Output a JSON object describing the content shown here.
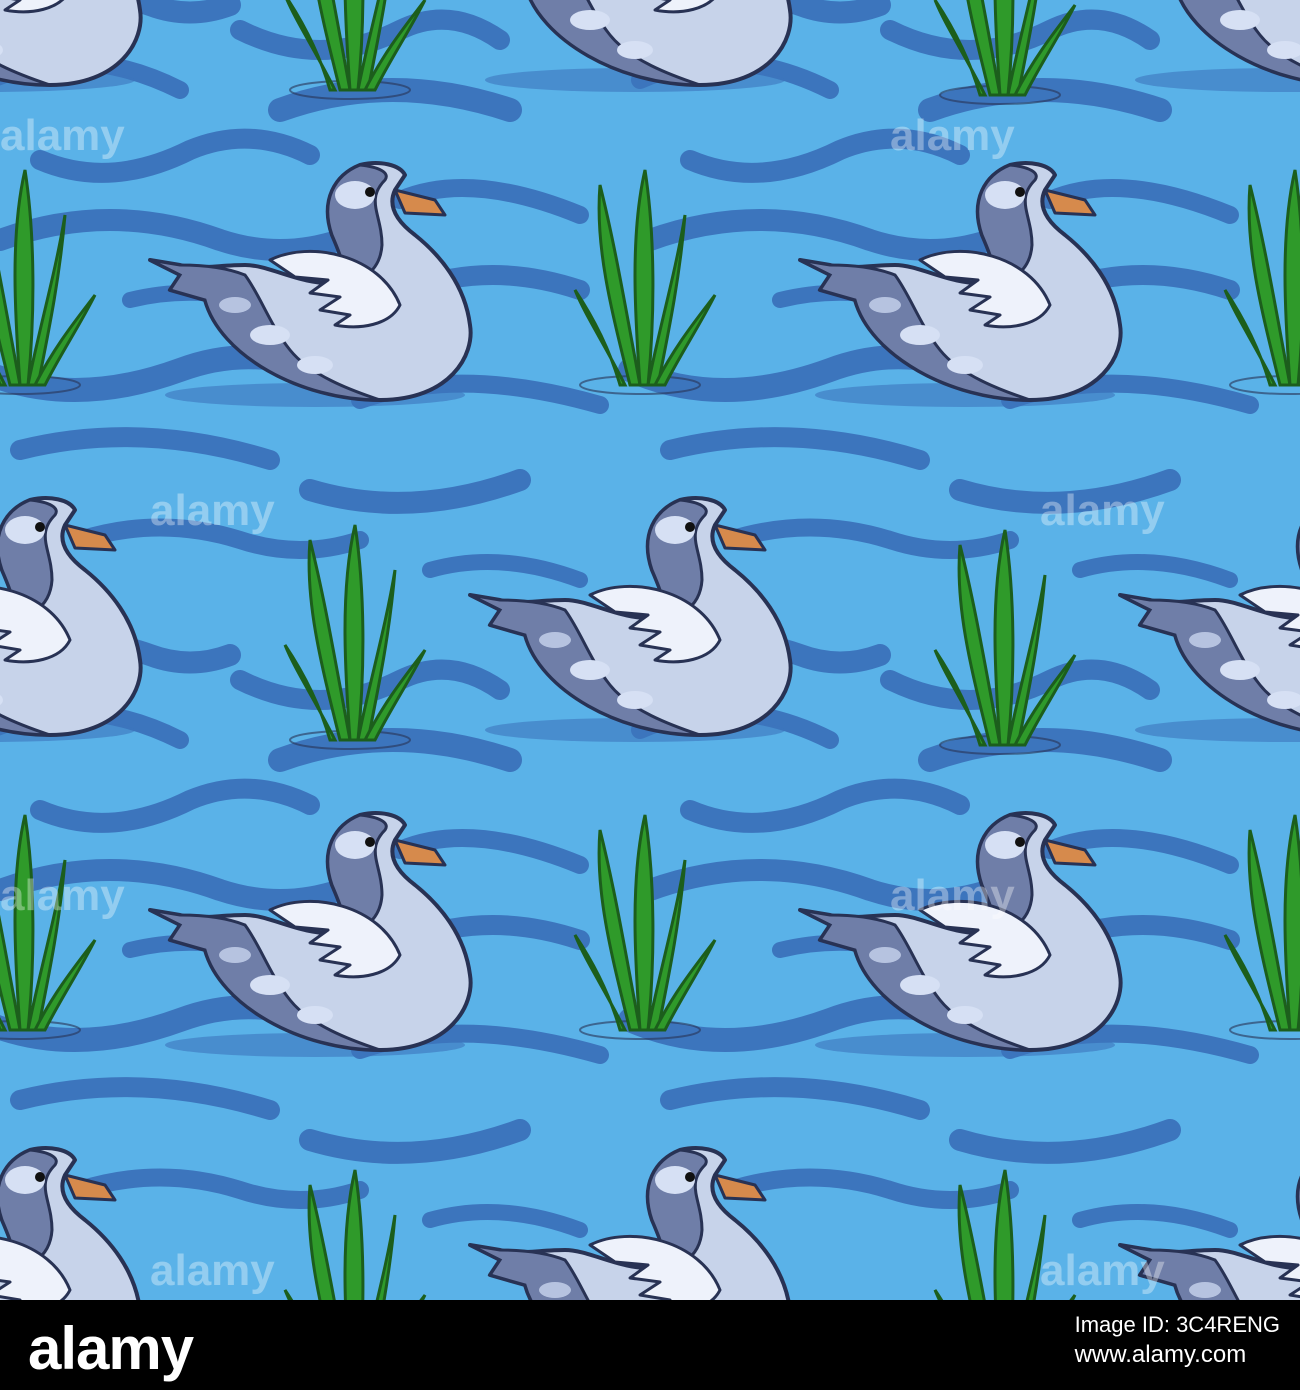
{
  "image": {
    "subject": "seamless pattern of grey swans and green reeds on blue rippled water",
    "colors": {
      "water": "#5ab2e8",
      "ripple": "#3c75bd",
      "swan_body": "#c7d3ea",
      "swan_dark": "#6f7ea8",
      "swan_outline": "#283254",
      "beak": "#d68a4c",
      "reed": "#2f9a2a",
      "reed_dark": "#1c5e1c"
    }
  },
  "watermark": {
    "text": "alamy"
  },
  "footer": {
    "logo": "alamy",
    "id_label": "Image ID: 3C4RENG",
    "url": "www.alamy.com"
  }
}
